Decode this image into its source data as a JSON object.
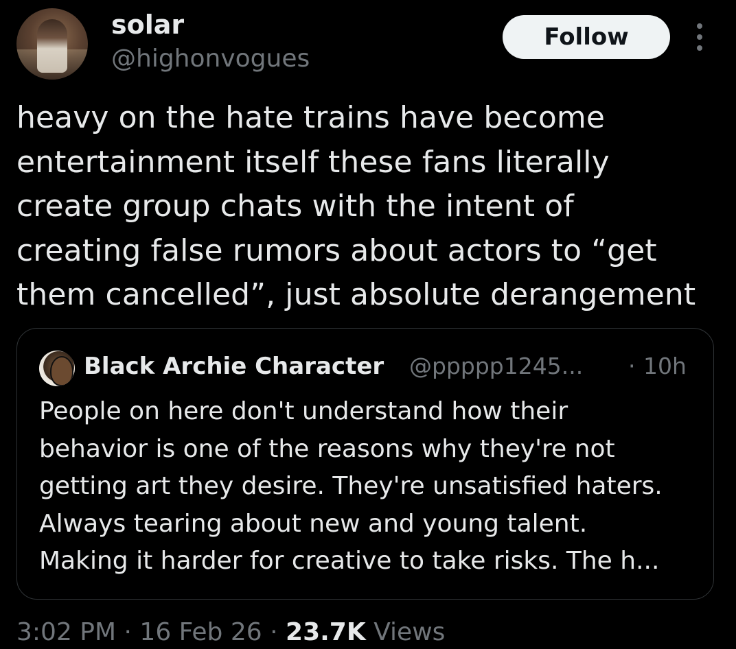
{
  "author": {
    "display_name": "solar",
    "handle": "@highonvogues",
    "avatar_icon": "profile-photo"
  },
  "follow_button": {
    "label": "Follow"
  },
  "more_menu": {
    "icon": "vertical-ellipsis-icon"
  },
  "tweet": {
    "text": "heavy on the hate trains have become\nentertainment itself these fans literally\ncreate group chats with the intent of\ncreating false rumors about actors to “get\nthem cancelled”, just absolute derangement"
  },
  "quote": {
    "display_name": "Black Archie Character",
    "handle": "@ppppp1245...",
    "separator": "·",
    "time": "10h",
    "text": "People on here don't understand how their\nbehavior is one of the reasons why they're not\ngetting art they desire. They're unsatisfied haters.\nAlways tearing about new and young talent.\nMaking it harder for creative to take risks. The h..."
  },
  "meta": {
    "time": "3:02 PM",
    "date": "16 Feb 26",
    "dot": "·",
    "views_count": "23.7K",
    "views_label": "Views"
  },
  "colors": {
    "background": "#000000",
    "primary_text": "#e7e9ea",
    "secondary_text": "#71767b",
    "border": "#2f3336",
    "follow_bg": "#eff3f4"
  }
}
